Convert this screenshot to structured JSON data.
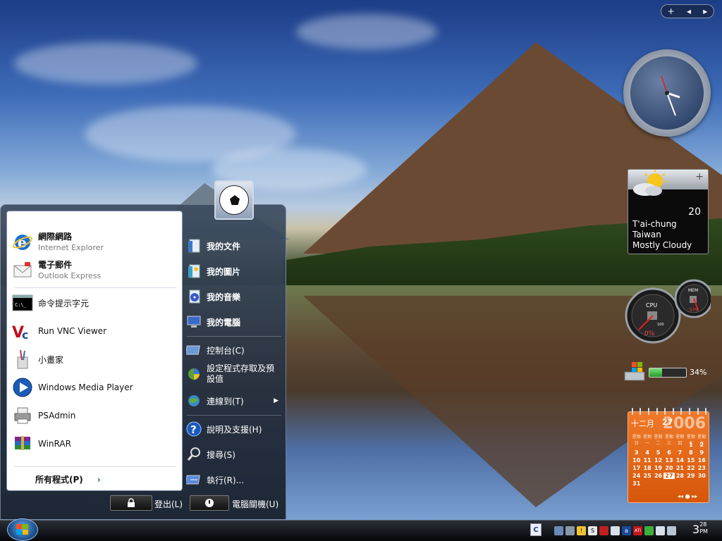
{
  "sidebar_control": {
    "add": "+",
    "prev": "◂",
    "next": "▸"
  },
  "weather": {
    "temperature": "20",
    "city": "T'ai-chung",
    "country": "Taiwan",
    "condition": "Mostly Cloudy",
    "plus": "+"
  },
  "meter": {
    "cpu_label": "CPU",
    "cpu_value": "0%",
    "cpu_max": "100",
    "mem_label": "MEM",
    "mem_value": "57%"
  },
  "battery": {
    "percent_text": "34%",
    "level": 0.34
  },
  "calendar": {
    "month": "十二月",
    "day": "27",
    "year": "2006",
    "weekdays": [
      "星期日",
      "星期一",
      "星期二",
      "星期三",
      "星期四",
      "星期五",
      "星期六"
    ],
    "days": [
      "",
      "",
      "",
      "",
      "",
      "1",
      "2",
      "3",
      "4",
      "5",
      "6",
      "7",
      "8",
      "9",
      "10",
      "11",
      "12",
      "13",
      "14",
      "15",
      "16",
      "17",
      "18",
      "19",
      "20",
      "21",
      "22",
      "23",
      "24",
      "25",
      "26",
      "27",
      "28",
      "29",
      "30",
      "31"
    ],
    "today": "27",
    "nav": "◂◂ ● ▸▸"
  },
  "start_menu": {
    "pinned": [
      {
        "title": "網際網路",
        "subtitle": "Internet Explorer",
        "icon": "internet-explorer-icon"
      },
      {
        "title": "電子郵件",
        "subtitle": "Outlook Express",
        "icon": "outlook-express-icon"
      }
    ],
    "recent": [
      {
        "title": "命令提示字元",
        "icon": "command-prompt-icon"
      },
      {
        "title": "Run VNC Viewer",
        "icon": "vnc-viewer-icon"
      },
      {
        "title": "小畫家",
        "icon": "paint-icon"
      },
      {
        "title": "Windows Media Player",
        "icon": "media-player-icon"
      },
      {
        "title": "PSAdmin",
        "icon": "psadmin-icon"
      },
      {
        "title": "WinRAR",
        "icon": "winrar-icon"
      }
    ],
    "all_programs": "所有程式(P)",
    "all_programs_arrow": "›",
    "right": [
      {
        "label": "我的文件",
        "icon": "documents-icon"
      },
      {
        "label": "我的圖片",
        "icon": "pictures-icon"
      },
      {
        "label": "我的音樂",
        "icon": "music-icon"
      },
      {
        "label": "我的電腦",
        "icon": "computer-icon"
      },
      {
        "label": "控制台(C)",
        "icon": "control-panel-icon"
      },
      {
        "label": "設定程式存取及預設值",
        "icon": "program-access-icon"
      },
      {
        "label": "連線到(T)",
        "icon": "connect-to-icon"
      },
      {
        "label": "說明及支援(H)",
        "icon": "help-icon"
      },
      {
        "label": "搜尋(S)",
        "icon": "search-icon"
      },
      {
        "label": "執行(R)...",
        "icon": "run-icon"
      }
    ],
    "submenu_arrow": "▶",
    "logoff": "登出(L)",
    "shutdown": "電腦關機(U)"
  },
  "taskbar": {
    "input_indicator": "C",
    "clock_hour_min": "3",
    "clock_minutes": "28",
    "clock_ampm": "PM",
    "tray_icons": [
      "network-icon",
      "settings-icon",
      "warning-icon",
      "s-icon",
      "shield-icon",
      "window-icon",
      "font-icon",
      "ati-icon",
      "wifi-icon",
      "display-icon",
      "volume-icon"
    ]
  }
}
